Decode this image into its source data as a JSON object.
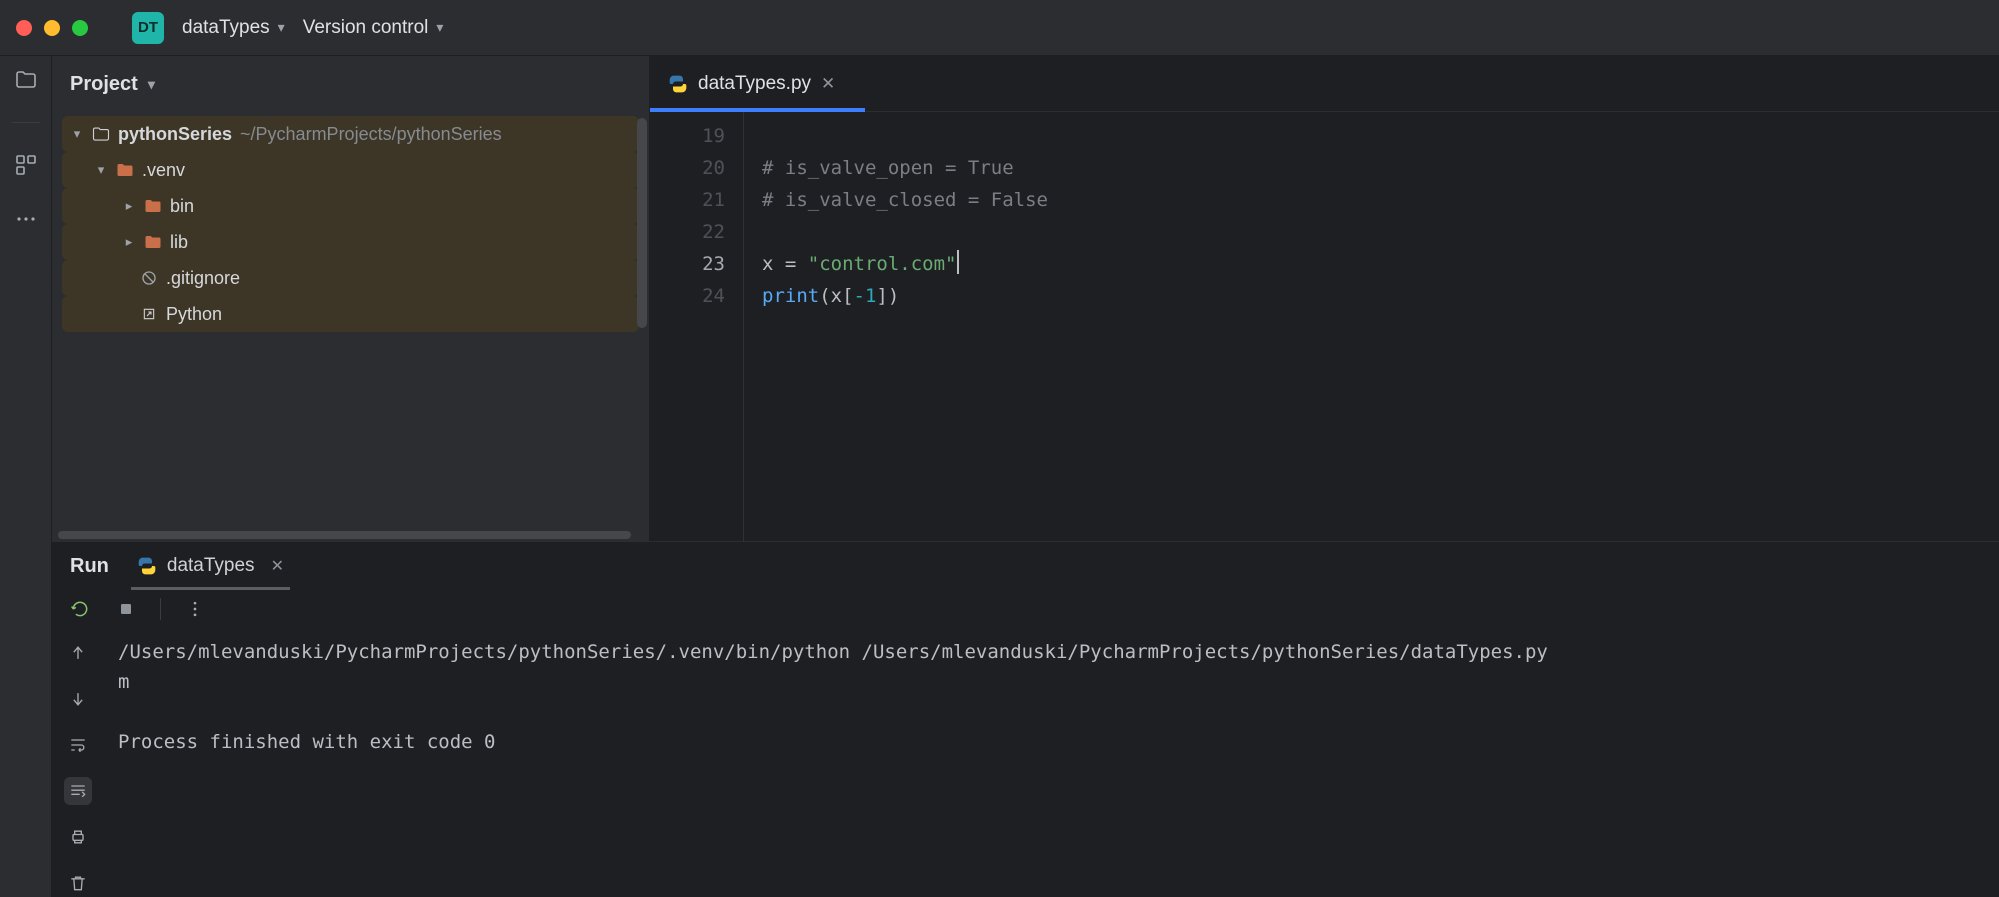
{
  "titlebar": {
    "badge": "DT",
    "project_name": "dataTypes",
    "vcs_menu": "Version control"
  },
  "project_panel": {
    "title": "Project",
    "root": {
      "name": "pythonSeries",
      "path": "~/PycharmProjects/pythonSeries"
    },
    "items": [
      {
        "name": ".venv"
      },
      {
        "name": "bin"
      },
      {
        "name": "lib"
      },
      {
        "name": ".gitignore"
      },
      {
        "name": "Python"
      }
    ]
  },
  "editor": {
    "tab": {
      "filename": "dataTypes.py"
    },
    "lines": [
      {
        "num": 19,
        "segments": []
      },
      {
        "num": 20,
        "segments": [
          {
            "t": "# is_valve_open = True",
            "cls": "tok-cmt"
          }
        ]
      },
      {
        "num": 21,
        "segments": [
          {
            "t": "# is_valve_closed = False",
            "cls": "tok-cmt"
          }
        ]
      },
      {
        "num": 22,
        "segments": []
      },
      {
        "num": 23,
        "segments": [
          {
            "t": "x ",
            "cls": "tok-id"
          },
          {
            "t": "= ",
            "cls": "tok-op"
          },
          {
            "t": "\"control.com\"",
            "cls": "tok-str"
          }
        ],
        "cursorAfter": true
      },
      {
        "num": 24,
        "segments": [
          {
            "t": "print",
            "cls": "tok-call"
          },
          {
            "t": "(x[",
            "cls": "tok-op"
          },
          {
            "t": "-1",
            "cls": "tok-num"
          },
          {
            "t": "])",
            "cls": "tok-op"
          }
        ]
      }
    ],
    "current_line": 23
  },
  "run": {
    "title": "Run",
    "config_name": "dataTypes",
    "output": {
      "cmd": "/Users/mlevanduski/PycharmProjects/pythonSeries/.venv/bin/python /Users/mlevanduski/PycharmProjects/pythonSeries/dataTypes.py",
      "result": "m",
      "exit": "Process finished with exit code 0"
    }
  }
}
